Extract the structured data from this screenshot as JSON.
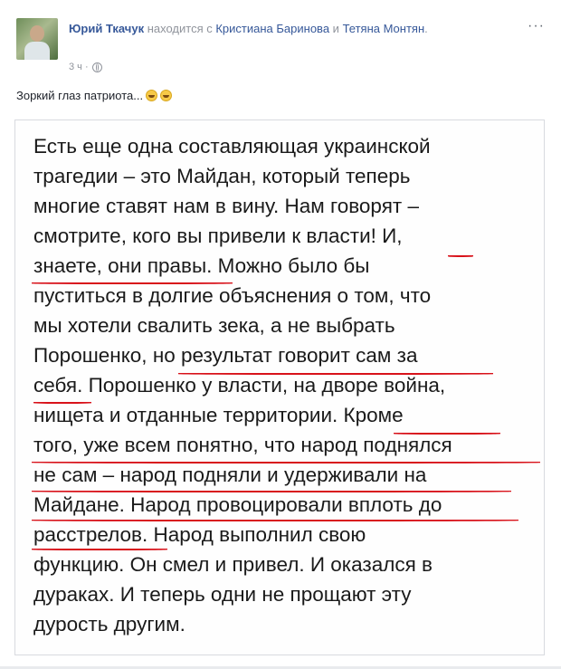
{
  "post": {
    "author": "Юрий Ткачук",
    "with_text": "находится с",
    "tagged_1": "Кристиана Баринова",
    "and_text": "и",
    "tagged_2": "Тетяна Монтян",
    "period": ".",
    "time": "3 ч ·",
    "caption": "Зоркий глаз патриота...",
    "menu": "···"
  },
  "image_text": {
    "lines": [
      "Есть еще одна составляющая украинской",
      "трагедии – это Майдан, который теперь",
      "многие ставят нам в вину. Нам говорят –",
      "смотрите, кого вы привели к власти! И,",
      "знаете, они правы. Можно было бы",
      "пуститься в долгие объяснения о том, что",
      "мы хотели свалить зека, а не выбрать",
      "Порошенко, но результат говорит сам за",
      "себя. Порошенко у власти, на дворе война,",
      "нищета и отданные территории. Кроме",
      "того, уже всем понятно, что народ поднялся",
      "не сам – народ подняли и удерживали на",
      "Майдане. Народ провоцировали вплоть до",
      "расстрелов. Народ выполнил свою",
      "функцию. Он смел и привел. И оказался в",
      "дураках. И теперь одни не прощают эту",
      "дурость другим."
    ]
  },
  "colors": {
    "link": "#365899",
    "meta": "#90949c",
    "underline": "#d8121a"
  },
  "icons": [
    "globe-icon",
    "grinning-emoji-icon",
    "menu-dots-icon"
  ]
}
